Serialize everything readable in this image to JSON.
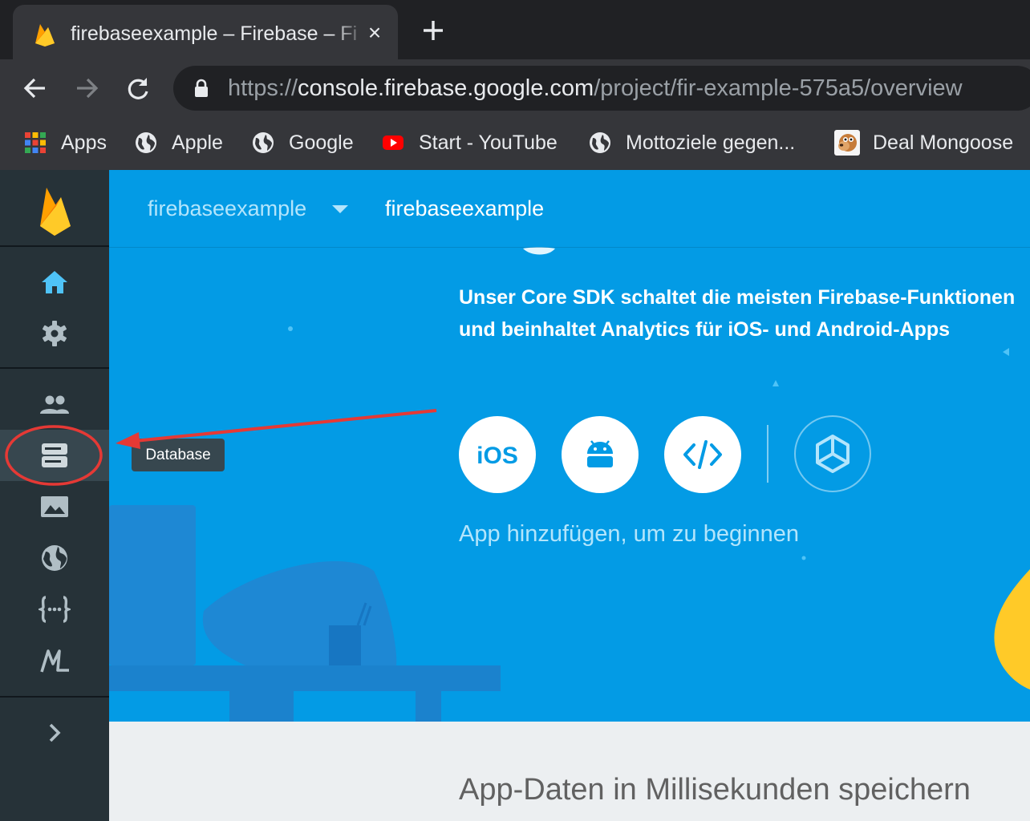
{
  "browser": {
    "tab": {
      "title": "firebaseexample – Firebase – Fi",
      "close_icon": "close-icon"
    },
    "new_tab_icon": "plus-icon",
    "url": {
      "scheme": "https://",
      "host": "console.firebase.google.com",
      "path": "/project/fir-example-575a5/overview"
    },
    "bookmarks": [
      {
        "label": "Apps",
        "icon": "apps-grid-icon"
      },
      {
        "label": "Apple",
        "icon": "globe-icon"
      },
      {
        "label": "Google",
        "icon": "globe-icon"
      },
      {
        "label": "Start - YouTube",
        "icon": "youtube-icon"
      },
      {
        "label": "Mottoziele gegen...",
        "icon": "globe-icon"
      },
      {
        "label": "Deal Mongoose",
        "icon": "mongoose-icon"
      }
    ]
  },
  "rail": {
    "items": [
      "home-icon",
      "settings-icon",
      "users-icon",
      "database-icon",
      "image-icon",
      "globe-icon",
      "functions-icon",
      "ml-icon",
      "chevron-right-icon"
    ],
    "active": "database-icon"
  },
  "header": {
    "project_selector": "firebaseexample",
    "project_name": "firebaseexample"
  },
  "hero": {
    "line1": "Unser Core SDK schaltet die meisten Firebase-Funktionen",
    "line2": "und beinhaltet Analytics für iOS- und Android-Apps",
    "platforms": [
      "iOS",
      "Android",
      "Web",
      "Unity"
    ],
    "add_app": "App hinzufügen, um zu beginnen"
  },
  "section": {
    "title": "App-Daten in Millisekunden speichern"
  },
  "tooltip": {
    "label": "Database"
  },
  "colors": {
    "firebase_blue": "#039be5",
    "rail": "#263238",
    "annotation_red": "#e53935",
    "firebase_yellow": "#ffca28"
  }
}
